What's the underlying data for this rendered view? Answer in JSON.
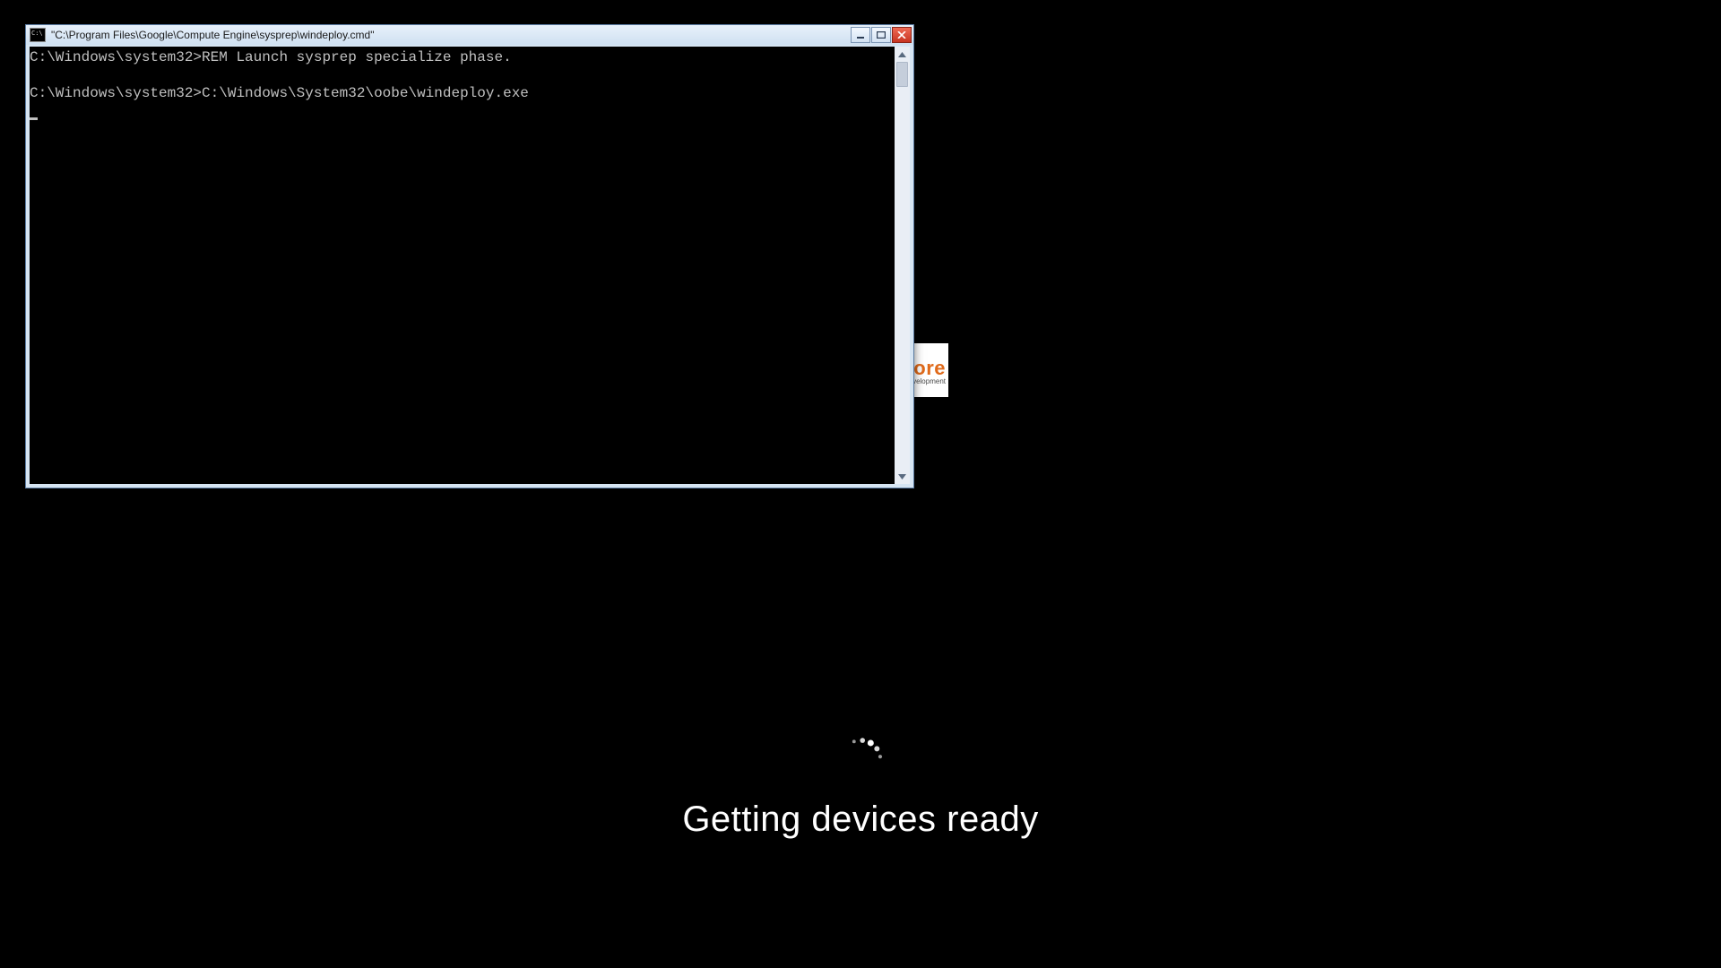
{
  "boot": {
    "status_text": "Getting devices ready"
  },
  "bg_fragment": {
    "line1": "ore",
    "line2": "velopment"
  },
  "cmd": {
    "title": "\"C:\\Program Files\\Google\\Compute Engine\\sysprep\\windeploy.cmd\"",
    "lines": [
      "C:\\Windows\\system32>REM Launch sysprep specialize phase.",
      "",
      "C:\\Windows\\system32>C:\\Windows\\System32\\oobe\\windeploy.exe"
    ]
  },
  "spinner_dots": [
    {
      "angle": -110,
      "r": 22,
      "scale": 0.55,
      "opacity": 0.6
    },
    {
      "angle": -85,
      "r": 22,
      "scale": 0.8,
      "opacity": 0.85
    },
    {
      "angle": -60,
      "r": 22,
      "scale": 1.0,
      "opacity": 1.0
    },
    {
      "angle": -35,
      "r": 22,
      "scale": 0.85,
      "opacity": 0.85
    },
    {
      "angle": -10,
      "r": 22,
      "scale": 0.6,
      "opacity": 0.6
    }
  ]
}
